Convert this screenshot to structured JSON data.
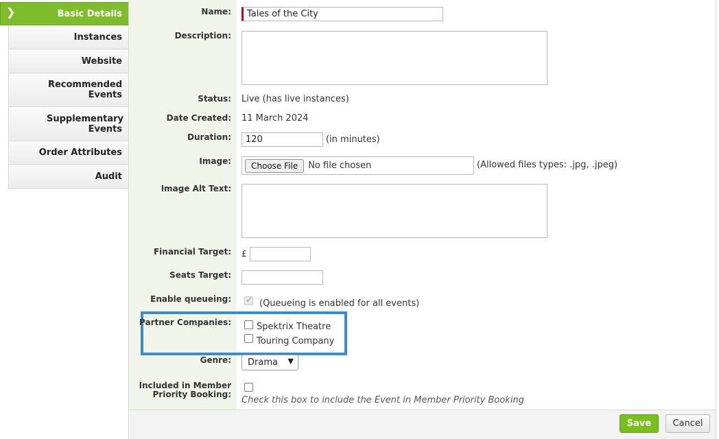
{
  "sidebar": {
    "items": [
      {
        "label": "Basic Details"
      },
      {
        "label": "Instances"
      },
      {
        "label": "Website"
      },
      {
        "label": "Recommended Events"
      },
      {
        "label": "Supplementary Events"
      },
      {
        "label": "Order Attributes"
      },
      {
        "label": "Audit"
      }
    ]
  },
  "form": {
    "name": {
      "label": "Name:",
      "value": "Tales of the City"
    },
    "description": {
      "label": "Description:",
      "value": ""
    },
    "status": {
      "label": "Status:",
      "value": "Live (has live instances)"
    },
    "date_created": {
      "label": "Date Created:",
      "value": "11 March 2024"
    },
    "duration": {
      "label": "Duration:",
      "value": "120",
      "suffix": "(in minutes)"
    },
    "image": {
      "label": "Image:",
      "button": "Choose File",
      "file_text": "No file chosen",
      "hint": "(Allowed files types: .jpg, .jpeg)"
    },
    "image_alt": {
      "label": "Image Alt Text:",
      "value": ""
    },
    "financial_target": {
      "label": "Financial Target:",
      "currency": "£",
      "value": ""
    },
    "seats_target": {
      "label": "Seats Target:",
      "value": ""
    },
    "queueing": {
      "label": "Enable queueing:",
      "checked": true,
      "note": "(Queueing is enabled for all events)"
    },
    "partner_companies": {
      "label": "Partner Companies:",
      "options": [
        {
          "label": "Spektrix Theatre",
          "checked": false
        },
        {
          "label": "Touring Company",
          "checked": false
        }
      ]
    },
    "genre": {
      "label": "Genre:",
      "value": "Drama"
    },
    "member_priority": {
      "label": "Included in Member Priority Booking:",
      "checked": false,
      "hint": "Check this box to include the Event in Member Priority Booking"
    }
  },
  "footer": {
    "save_label": "Save",
    "cancel_label": "Cancel"
  },
  "colors": {
    "accent_green": "#7dbd2b",
    "highlight_blue": "#3d8dc2",
    "required_red": "#d0021b"
  }
}
